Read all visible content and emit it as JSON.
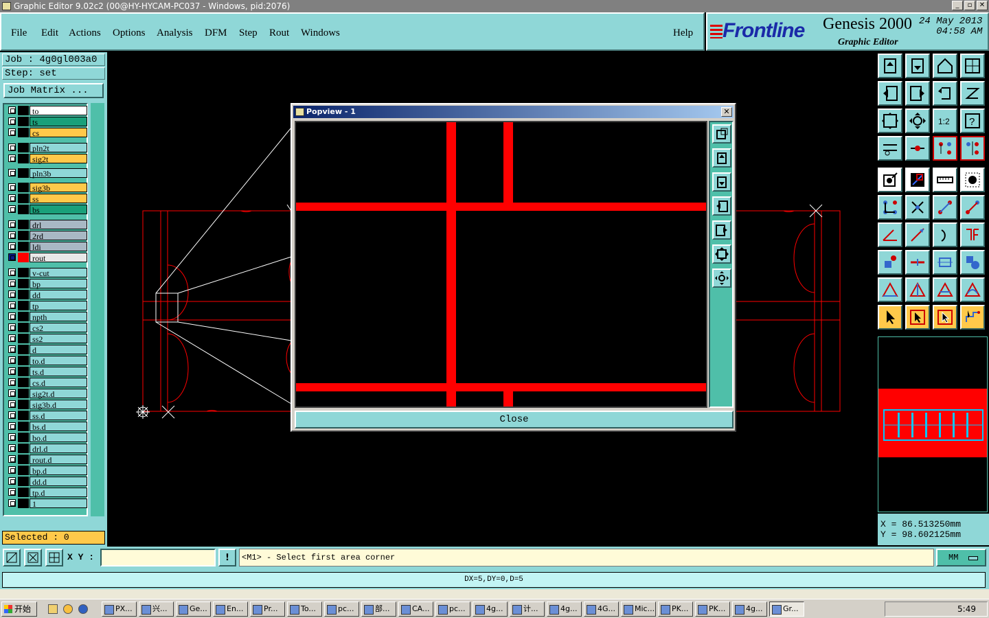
{
  "window": {
    "title": "Graphic Editor 9.02c2 (00@HY-HYCAM-PC037 - Windows, pid:2076)"
  },
  "menu": [
    "File",
    "Edit",
    "Actions",
    "Options",
    "Analysis",
    "DFM",
    "Step",
    "Rout",
    "Windows"
  ],
  "help": "Help",
  "logo": {
    "brand": "Frontline",
    "product": "Genesis 2000",
    "subtitle": "Graphic Editor",
    "date": "24 May 2013",
    "time": "04:58 AM"
  },
  "job": {
    "job_line": "Job : 4g0gl003a0",
    "step_line": "Step: set",
    "matrix_button": "Job Matrix ..."
  },
  "layers": [
    {
      "name": "to",
      "color": "#ffffff"
    },
    {
      "name": "ts",
      "color": "#1aa07a"
    },
    {
      "name": "cs",
      "color": "#ffc94a"
    },
    {
      "name": "pln2t",
      "color": "#8fd7d7"
    },
    {
      "name": "sig2t",
      "color": "#ffc94a"
    },
    {
      "name": "pln3b",
      "color": "#8fd7d7"
    },
    {
      "name": "sig3b",
      "color": "#ffc94a"
    },
    {
      "name": "ss",
      "color": "#ffc94a"
    },
    {
      "name": "bs",
      "color": "#1aa07a"
    },
    {
      "name": "drl",
      "color": "#a8b8c4"
    },
    {
      "name": "2rd",
      "color": "#a8b8c4"
    },
    {
      "name": "ldi",
      "color": "#a8b8c4"
    },
    {
      "name": "rout",
      "color": "#e8e8e8",
      "active": true
    },
    {
      "name": "v-cut",
      "color": "#8fd7d7"
    },
    {
      "name": "bp",
      "color": "#8fd7d7"
    },
    {
      "name": "dd",
      "color": "#8fd7d7"
    },
    {
      "name": "tp",
      "color": "#8fd7d7"
    },
    {
      "name": "npth",
      "color": "#8fd7d7"
    },
    {
      "name": "cs2",
      "color": "#8fd7d7"
    },
    {
      "name": "ss2",
      "color": "#8fd7d7"
    },
    {
      "name": "d",
      "color": "#8fd7d7"
    },
    {
      "name": "to.d",
      "color": "#8fd7d7"
    },
    {
      "name": "ts.d",
      "color": "#8fd7d7"
    },
    {
      "name": "cs.d",
      "color": "#8fd7d7"
    },
    {
      "name": "sig2t.d",
      "color": "#8fd7d7"
    },
    {
      "name": "sig3b.d",
      "color": "#8fd7d7"
    },
    {
      "name": "ss.d",
      "color": "#8fd7d7"
    },
    {
      "name": "bs.d",
      "color": "#8fd7d7"
    },
    {
      "name": "bo.d",
      "color": "#8fd7d7"
    },
    {
      "name": "drl.d",
      "color": "#8fd7d7"
    },
    {
      "name": "rout.d",
      "color": "#8fd7d7"
    },
    {
      "name": "bp.d",
      "color": "#8fd7d7"
    },
    {
      "name": "dd.d",
      "color": "#8fd7d7"
    },
    {
      "name": "tp.d",
      "color": "#8fd7d7"
    },
    {
      "name": "1",
      "color": "#8fd7d7"
    }
  ],
  "selected": "Selected : 0",
  "popup": {
    "title": "Popview - 1",
    "close_label": "Close"
  },
  "coords": {
    "x": "X = 86.513250mm",
    "y": "Y = 98.602125mm"
  },
  "command": {
    "xy_label": "X Y :",
    "prompt": "<M1> - Select first area corner",
    "units": "MM"
  },
  "status": "DX=5,DY=0,D=5",
  "taskbar": {
    "start": "开始",
    "tasks": [
      "PX...",
      "兴...",
      "Ge...",
      "En...",
      "Pr...",
      "To...",
      "pc...",
      "部...",
      "CA...",
      "pc...",
      "4g...",
      "计...",
      "4g...",
      "4G...",
      "Mic...",
      "PK...",
      "PK...",
      "4g...",
      "Gr..."
    ],
    "clock": "5:49"
  },
  "colors": {
    "accent": "#8fd7d7",
    "layer_line": "#ff0000",
    "highlight": "#ffc94a"
  }
}
